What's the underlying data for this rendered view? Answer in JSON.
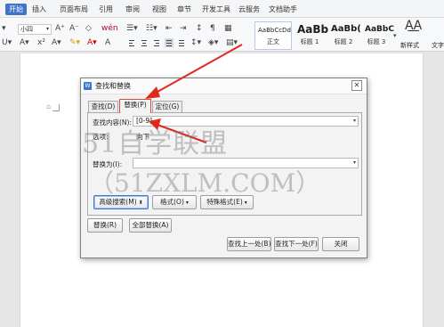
{
  "menubar": {
    "items": [
      "开始",
      "插入",
      "页面布局",
      "引用",
      "审阅",
      "视图",
      "章节",
      "开发工具",
      "云服务",
      "文档助手"
    ],
    "active_index": 0,
    "active_color": "#3f74c9"
  },
  "toolbar": {
    "font_size": "小四",
    "styles": [
      {
        "sample": "AaBbCcDd",
        "label": "正文"
      },
      {
        "sample": "AaBb",
        "label": "标题 1"
      },
      {
        "sample": "AaBb(",
        "label": "标题 2"
      },
      {
        "sample": "AaBbC",
        "label": "标题 3"
      }
    ],
    "new_style_label": "新样式",
    "text_tool_label": "文字"
  },
  "dialog": {
    "title": "查找和替换",
    "tabs": [
      "查找(D)",
      "替换(P)",
      "定位(G)"
    ],
    "active_tab": 1,
    "find_label": "查找内容(N):",
    "find_value": "[0-9]",
    "options_label": "选项:",
    "options_value": "向下",
    "replace_label": "替换为(I):",
    "replace_value": "",
    "advanced_search": "高级搜索(M)",
    "format": "格式(O)",
    "special_format": "特殊格式(E)",
    "replace_button": "替换(R)",
    "replace_all_button": "全部替换(A)",
    "find_prev": "查找上一处(B)",
    "find_next": "查找下一处(F)",
    "close": "关闭",
    "close_icon": "close-icon",
    "highlight_color": "#e04a3a"
  },
  "watermark": {
    "line1": "51自学联盟",
    "line2": "（51ZXLM.COM）"
  }
}
